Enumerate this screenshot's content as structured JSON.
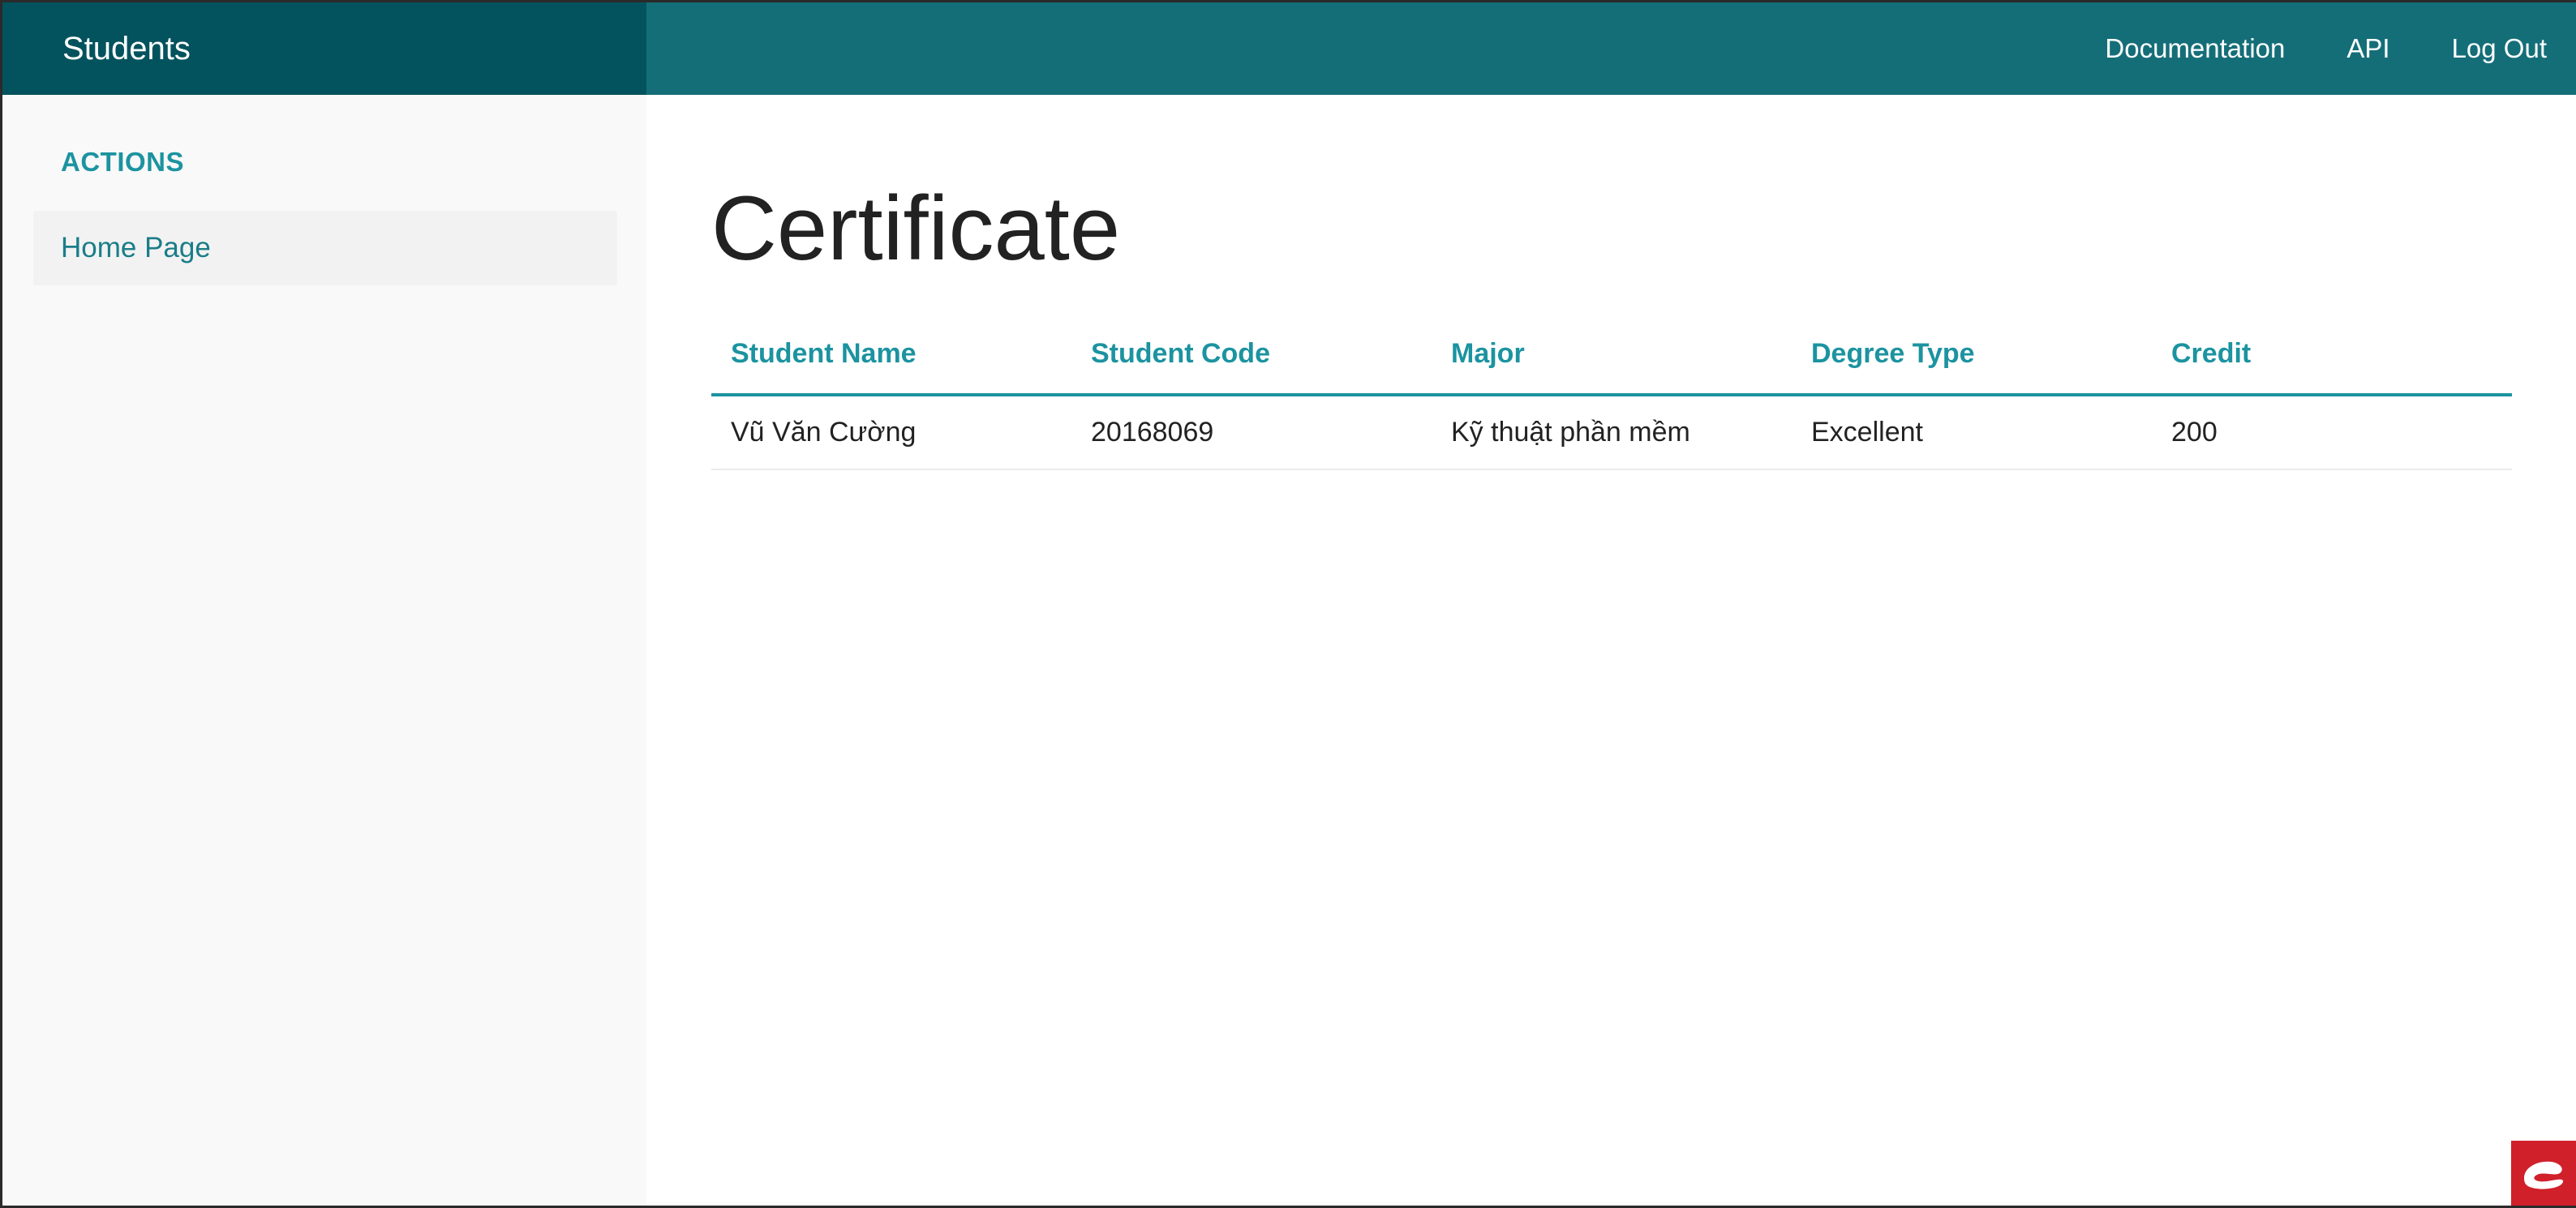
{
  "navbar": {
    "brand": "Students",
    "links": [
      "Documentation",
      "API",
      "Log Out"
    ]
  },
  "sidebar": {
    "heading": "ACTIONS",
    "items": [
      {
        "label": "Home Page"
      }
    ]
  },
  "main": {
    "title": "Certificate",
    "table": {
      "columns": [
        "Student Name",
        "Student Code",
        "Major",
        "Degree Type",
        "Credit"
      ],
      "rows": [
        [
          "Vũ Văn Cường",
          "20168069",
          "Kỹ thuật phần mềm",
          "Excellent",
          "200"
        ]
      ]
    }
  },
  "colors": {
    "brand_bg": "#03535e",
    "navbar_bg": "#146e78",
    "accent": "#1c93a0",
    "sidebar_bg": "#f9f9f9"
  },
  "icons": {
    "corner_badge": "app-logo-icon"
  }
}
